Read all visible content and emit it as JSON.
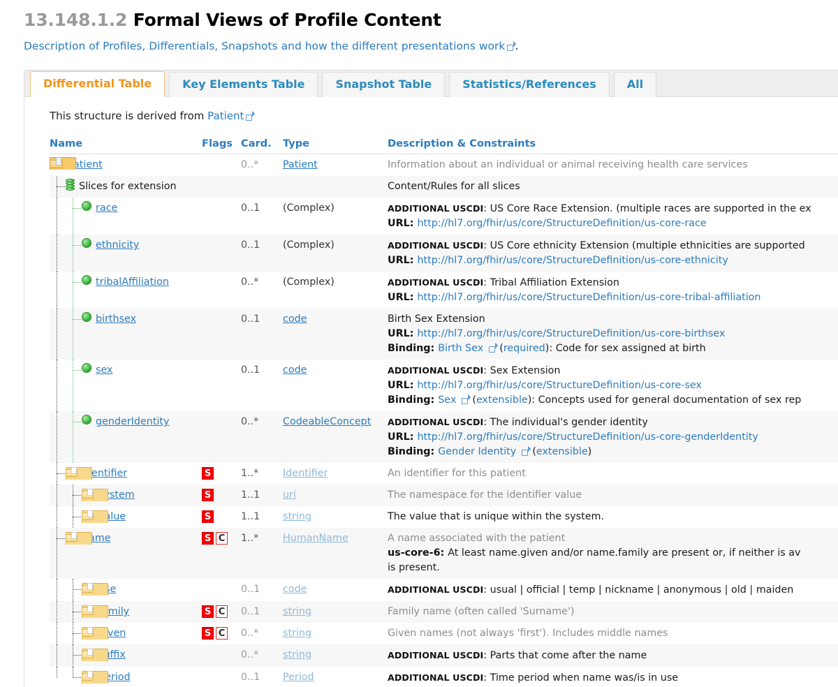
{
  "header": {
    "section_number": "13.148.1.2",
    "title": "Formal Views of Profile Content",
    "subtitle_text": "Description of Profiles, Differentials, Snapshots and how the different presentations work",
    "subtitle_tail": "."
  },
  "tabs": [
    {
      "label": "Differential Table",
      "active": true
    },
    {
      "label": "Key Elements Table",
      "active": false
    },
    {
      "label": "Snapshot Table",
      "active": false
    },
    {
      "label": "Statistics/References",
      "active": false
    },
    {
      "label": "All",
      "active": false
    }
  ],
  "derived": {
    "prefix": "This structure is derived from ",
    "link": "Patient"
  },
  "table": {
    "columns": [
      "Name",
      "Flags",
      "Card.",
      "Type",
      "Description & Constraints"
    ],
    "rows": [
      {
        "name": "Patient",
        "icon": "resource-icon",
        "depth": 0,
        "flags": [],
        "card": "0..*",
        "card_muted": true,
        "type": "Patient",
        "type_style": "link",
        "desc_lines": [
          {
            "text": "Information about an individual or animal receiving health care services",
            "style": "muted"
          }
        ]
      },
      {
        "name": "Slices for extension",
        "icon": "slice-icon",
        "depth": 1,
        "name_style": "plain",
        "flags": [],
        "card": "",
        "card_muted": true,
        "type": "",
        "type_style": "plain",
        "desc_lines": [
          {
            "text": "Content/Rules for all slices",
            "style": "norm"
          }
        ]
      },
      {
        "name": "race",
        "icon": "extension-icon",
        "depth": 2,
        "flags": [],
        "card": "0..1",
        "card_muted": false,
        "type": "(Complex)",
        "type_style": "plain",
        "desc_lines": [
          {
            "prefix": "ADDITIONAL USCDI",
            "text": ": US Core Race Extension. (multiple races are supported in the ex",
            "style": "norm"
          },
          {
            "label": "URL: ",
            "link": "http://hl7.org/fhir/us/core/StructureDefinition/us-core-race"
          }
        ]
      },
      {
        "name": "ethnicity",
        "icon": "extension-icon",
        "depth": 2,
        "flags": [],
        "card": "0..1",
        "card_muted": false,
        "type": "(Complex)",
        "type_style": "plain",
        "desc_lines": [
          {
            "prefix": "ADDITIONAL USCDI",
            "text": ": US Core ethnicity Extension (multiple ethnicities are supported",
            "style": "norm"
          },
          {
            "label": "URL: ",
            "link": "http://hl7.org/fhir/us/core/StructureDefinition/us-core-ethnicity"
          }
        ]
      },
      {
        "name": "tribalAffiliation",
        "icon": "extension-icon",
        "depth": 2,
        "flags": [],
        "card": "0..*",
        "card_muted": false,
        "type": "(Complex)",
        "type_style": "plain",
        "desc_lines": [
          {
            "prefix": "ADDITIONAL USCDI",
            "text": ": Tribal Affiliation Extension",
            "style": "norm"
          },
          {
            "label": "URL: ",
            "link": "http://hl7.org/fhir/us/core/StructureDefinition/us-core-tribal-affiliation"
          }
        ]
      },
      {
        "name": "birthsex",
        "icon": "extension-icon",
        "depth": 2,
        "flags": [],
        "card": "0..1",
        "card_muted": false,
        "type": "code",
        "type_style": "link",
        "desc_lines": [
          {
            "text": "Birth Sex Extension",
            "style": "norm"
          },
          {
            "label": "URL: ",
            "link": "http://hl7.org/fhir/us/core/StructureDefinition/us-core-birthsex"
          },
          {
            "label": "Binding: ",
            "binding_link": "Birth Sex",
            "binding_ext": true,
            "binding_strength": "(required)",
            "binding_tail": ": Code for sex assigned at birth"
          }
        ]
      },
      {
        "name": "sex",
        "icon": "extension-icon",
        "depth": 2,
        "flags": [],
        "card": "0..1",
        "card_muted": false,
        "type": "code",
        "type_style": "link",
        "desc_lines": [
          {
            "prefix": "ADDITIONAL USCDI",
            "text": ": Sex Extension",
            "style": "norm"
          },
          {
            "label": "URL: ",
            "link": "http://hl7.org/fhir/us/core/StructureDefinition/us-core-sex"
          },
          {
            "label": "Binding: ",
            "binding_link": "Sex",
            "binding_ext": true,
            "binding_strength": "(extensible)",
            "binding_tail": ": Concepts used for general documentation of sex rep"
          }
        ]
      },
      {
        "name": "genderIdentity",
        "icon": "extension-icon",
        "depth": 2,
        "flags": [],
        "card": "0..*",
        "card_muted": false,
        "type": "CodeableConcept",
        "type_style": "link",
        "desc_lines": [
          {
            "prefix": "ADDITIONAL USCDI",
            "text": ": The individual's gender identity",
            "style": "norm"
          },
          {
            "label": "URL: ",
            "link": "http://hl7.org/fhir/us/core/StructureDefinition/us-core-genderIdentity"
          },
          {
            "label": "Binding: ",
            "binding_link": "Gender Identity",
            "binding_ext": true,
            "binding_strength": "(extensible)",
            "binding_tail": ""
          }
        ]
      },
      {
        "name": "identifier",
        "icon": "element-icon",
        "depth": 1,
        "flags": [
          "S"
        ],
        "card": "1..*",
        "card_muted": false,
        "type": "Identifier",
        "type_style": "muted",
        "desc_lines": [
          {
            "text": "An identifier for this patient",
            "style": "muted"
          }
        ]
      },
      {
        "name": "system",
        "icon": "element-icon",
        "depth": 2,
        "flags": [
          "S"
        ],
        "card": "1..1",
        "card_muted": false,
        "type": "uri",
        "type_style": "muted",
        "desc_lines": [
          {
            "text": "The namespace for the identifier value",
            "style": "muted"
          }
        ]
      },
      {
        "name": "value",
        "icon": "element-icon",
        "depth": 2,
        "flags": [
          "S"
        ],
        "card": "1..1",
        "card_muted": false,
        "type": "string",
        "type_style": "muted",
        "desc_lines": [
          {
            "text": "The value that is unique within the system.",
            "style": "norm"
          }
        ]
      },
      {
        "name": "name",
        "icon": "element-icon",
        "depth": 1,
        "flags": [
          "S",
          "C"
        ],
        "card": "1..*",
        "card_muted": false,
        "type": "HumanName",
        "type_style": "muted",
        "desc_lines": [
          {
            "text": "A name associated with the patient",
            "style": "muted"
          },
          {
            "label": "us-core-6: ",
            "text": "At least name.given and/or name.family are present or, if neither is av",
            "style": "norm"
          },
          {
            "text": "is present.",
            "style": "norm"
          }
        ]
      },
      {
        "name": "use",
        "icon": "element-icon",
        "depth": 2,
        "flags": [],
        "card": "0..1",
        "card_muted": true,
        "type": "code",
        "type_style": "muted",
        "desc_lines": [
          {
            "prefix": "ADDITIONAL USCDI",
            "text": ": usual | official | temp | nickname | anonymous | old | maiden",
            "style": "norm"
          }
        ]
      },
      {
        "name": "family",
        "icon": "element-icon",
        "depth": 2,
        "flags": [
          "S",
          "C"
        ],
        "card": "0..1",
        "card_muted": true,
        "type": "string",
        "type_style": "muted",
        "desc_lines": [
          {
            "text": "Family name (often called 'Surname')",
            "style": "muted"
          }
        ]
      },
      {
        "name": "given",
        "icon": "element-icon",
        "depth": 2,
        "flags": [
          "S",
          "C"
        ],
        "card": "0..*",
        "card_muted": true,
        "type": "string",
        "type_style": "muted",
        "desc_lines": [
          {
            "text": "Given names (not always 'first'). Includes middle names",
            "style": "muted"
          }
        ]
      },
      {
        "name": "suffix",
        "icon": "element-icon",
        "depth": 2,
        "flags": [],
        "card": "0..*",
        "card_muted": true,
        "type": "string",
        "type_style": "muted",
        "desc_lines": [
          {
            "prefix": "ADDITIONAL USCDI",
            "text": ": Parts that come after the name",
            "style": "norm"
          }
        ]
      },
      {
        "name": "period",
        "icon": "element-icon",
        "depth": 2,
        "flags": [],
        "card": "0..1",
        "card_muted": true,
        "type": "Period",
        "type_style": "muted",
        "desc_lines": [
          {
            "prefix": "ADDITIONAL USCDI",
            "text": ": Time period when name was/is in use",
            "style": "norm"
          }
        ]
      }
    ]
  },
  "colors": {
    "link": "#2b7cbf",
    "accent_orange": "#f0941e",
    "flag_s_bg": "#f40000",
    "flag_c_border": "#e03030",
    "muted_text": "#8d8d8d",
    "green_icon": "#2faa2f"
  }
}
